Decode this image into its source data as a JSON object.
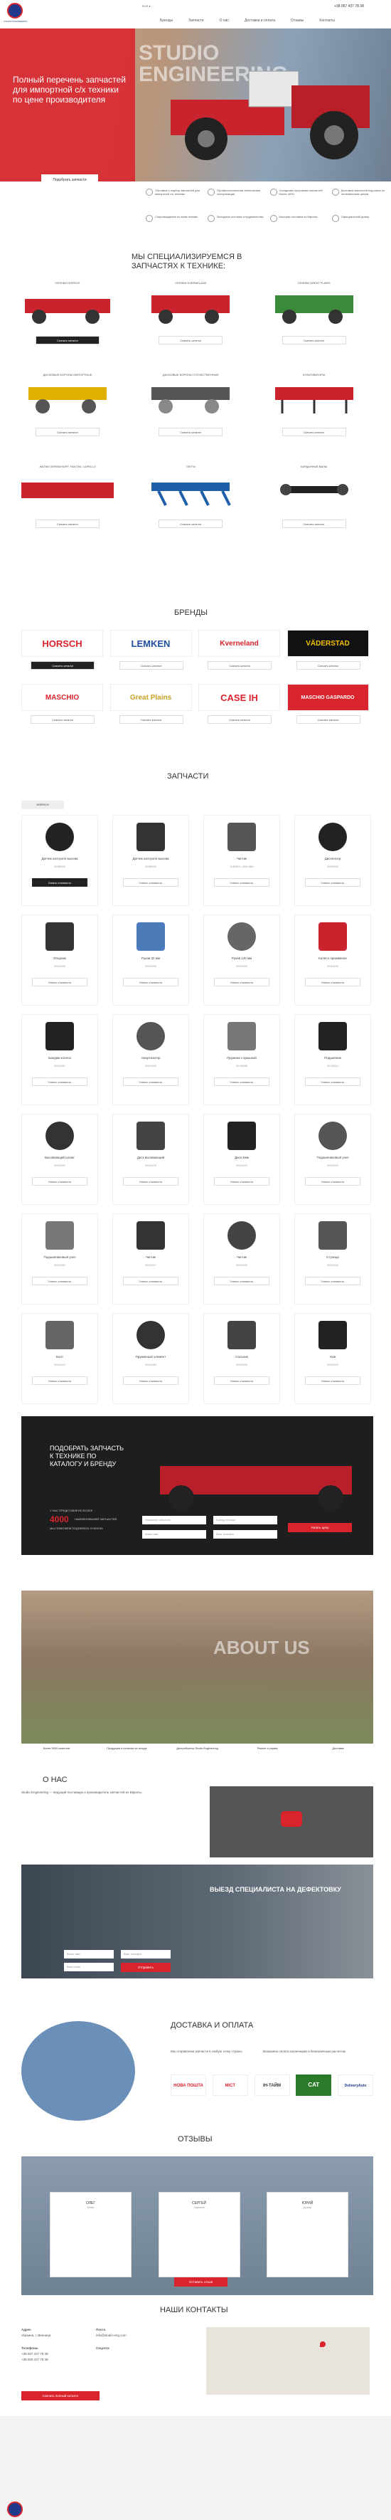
{
  "header": {
    "logo_text": "STUDIO ENGINEERING",
    "topbar": "RUS ▾",
    "phone": "+38 067 437 78 38",
    "nav": [
      "Бренды",
      "Запчасти",
      "О нас",
      "Доставка и оплата",
      "Отзывы",
      "Контакты"
    ]
  },
  "hero": {
    "title": "Полный перечень запчастей для импортной с/х техники по цене производителя",
    "button": "Подобрать запчасти",
    "watermark_line1": "STUDIO",
    "watermark_line2": "ENGINEERING",
    "features": [
      "Поставка и подбор запчастей для импортной с/х техники",
      "Профессиональная техническая консультация",
      "Складская программа запчастей более 4000",
      "Доставка запчастей под заказ по оптимальным ценам",
      "Сопровождение по всем этапам",
      "Выгодные условия сотрудничества",
      "Быстрая поставка из Европы",
      "Официальный дилер"
    ]
  },
  "catalog": {
    "title": "МЫ СПЕЦИАЛИЗИРУЕМСЯ В ЗАПЧАСТЯХ К ТЕХНИКЕ:",
    "items": [
      {
        "name": "СЕЯЛКИ HORSCH",
        "button": "Скачать каталог"
      },
      {
        "name": "СЕЯЛКИ KVERNELAND",
        "button": "Скачать каталог"
      },
      {
        "name": "СЕЯЛКИ GREAT PLAINS",
        "button": "Скачать каталог"
      },
      {
        "name": "ДИСКОВЫЕ БОРОНЫ ИМПОРТНЫЕ",
        "button": "Скачать каталог"
      },
      {
        "name": "ДИСКОВЫЕ БОРОНЫ ОТЕЧЕСТВЕННЫЕ",
        "button": "Скачать каталог"
      },
      {
        "name": "КУЛЬТИВАТОРЫ",
        "button": "Скачать каталог"
      },
      {
        "name": "ЖАТКИ GERINGHOFF, FANTINI, CAPELLO",
        "button": "Скачать каталог"
      },
      {
        "name": "ПЛУГИ",
        "button": "Скачать каталог"
      },
      {
        "name": "КАРДАННЫЕ ВАЛЫ",
        "button": "Скачать каталог"
      }
    ]
  },
  "brands": {
    "title": "БРЕНДЫ",
    "items": [
      {
        "name": "HORSCH",
        "color": "#d9232d",
        "button": "Скачать каталог"
      },
      {
        "name": "LEMKEN",
        "color": "#1e4e9c",
        "button": "Скачать каталог"
      },
      {
        "name": "Kverneland",
        "color": "#d9232d",
        "button": "Скачать каталог"
      },
      {
        "name": "VÄDERSTAD",
        "color": "#f2c200",
        "button": "Скачать каталог"
      },
      {
        "name": "MASCHIO",
        "color": "#d9232d",
        "button": "Скачать каталог"
      },
      {
        "name": "Great Plains",
        "color": "#c9a227",
        "button": "Скачать каталог"
      },
      {
        "name": "CASE IH",
        "color": "#d9232d",
        "button": "Скачать каталог"
      },
      {
        "name": "MASCHIO GASPARDO",
        "color": "#d9232d",
        "button": "Скачать каталог"
      }
    ]
  },
  "parts": {
    "title": "ЗАПЧАСТИ",
    "filter": "HORSCH",
    "button": "Узнать стоимость",
    "items": [
      {
        "name": "Датчик контроля высева",
        "code": "00380026"
      },
      {
        "name": "Датчик контроля высева",
        "code": "00380026"
      },
      {
        "name": "Чистик",
        "code": "01309921, 00310864"
      },
      {
        "name": "Диспенсер",
        "code": "00300000"
      },
      {
        "name": "Опорник",
        "code": "00310400"
      },
      {
        "name": "Рукав 32 мм",
        "code": "00330900"
      },
      {
        "name": "Рукав 145 мм",
        "code": "00330903"
      },
      {
        "name": "Колесо прижимное",
        "code": "00320140"
      },
      {
        "name": "Бандаж колеса",
        "code": "00320301"
      },
      {
        "name": "Амортизатор",
        "code": "00610019"
      },
      {
        "name": "Пружина с крышкой",
        "code": "00100088"
      },
      {
        "name": "Подшипник",
        "code": "00120014"
      },
      {
        "name": "Высевающий шланг",
        "code": "00330001"
      },
      {
        "name": "Диск высевающий",
        "code": "00300075"
      },
      {
        "name": "Диск 4мм",
        "code": "00300019"
      },
      {
        "name": "Подшипниковый узел",
        "code": "00330020"
      },
      {
        "name": "Подшипниковый узел",
        "code": "00310062"
      },
      {
        "name": "Чистик",
        "code": "00310017"
      },
      {
        "name": "Чистик",
        "code": "00200018"
      },
      {
        "name": "Ступица",
        "code": "00320044"
      },
      {
        "name": "Болт",
        "code": "00600010"
      },
      {
        "name": "Пружинный элемент",
        "code": "00310063"
      },
      {
        "name": "Сальник",
        "code": "00320040"
      },
      {
        "name": "Нож",
        "code": "00320019"
      }
    ]
  },
  "selector": {
    "title": "ПОДОБРАТЬ ЗАПЧАСТЬ К ТЕХНИКЕ ПО КАТАЛОГУ И БРЕНДУ",
    "count_prefix": "У НАС ПРЕДСТАВЛЕНО БОЛЕЕ",
    "count": "4000",
    "count_suffix": "НАИМЕНОВАНИЙ ЗАПЧАСТЕЙ.",
    "note": "МЫ ПОМОЖЕМ ПОДОБРАТЬ НУЖНУЮ",
    "fields": [
      "Название запчасти",
      "Бренд техники",
      "Ваше имя",
      "Ваш телефон"
    ],
    "button": "Узнать цену"
  },
  "about": {
    "title": "О НАС",
    "watermark": "ABOUT US",
    "text": "Studio Engineering — ведущий поставщик и производитель запчастей из Европы.",
    "stats": [
      "Более 5000 клиентов",
      "Продукция в наличии на складе",
      "Дистрибьютор Studio Engineering",
      "Ремонт и сервис",
      "Доставка"
    ]
  },
  "specialist": {
    "title": "ВЫЕЗД СПЕЦИАЛИСТА НА ДЕФЕКТОВКУ",
    "fields": [
      "Ваше имя",
      "Ваш телефон",
      "Ваш email"
    ],
    "button": "Отправить"
  },
  "delivery": {
    "title": "ДОСТАВКА И ОПЛАТА",
    "text1": "Мы отправляем запчасти в любую точку страны",
    "text2": "Возможна оплата наличными и безналичным расчетом",
    "carriers": [
      "НОВА ПОШТА",
      "МІСТ",
      "ІН-ТАЙМ",
      "CAT",
      "DeliveryAuto"
    ]
  },
  "reviews": {
    "title": "ОТЗЫВЫ",
    "items": [
      {
        "name": "ОЛЕГ",
        "city": "Киев"
      },
      {
        "name": "СЕРГЕЙ",
        "city": "Харьков"
      },
      {
        "name": "ЮРИЙ",
        "city": "Днепр"
      }
    ],
    "button": "Оставить отзыв"
  },
  "contacts": {
    "title": "НАШИ КОНТАКТЫ",
    "address_label": "Адрес",
    "address": "Украина, г. Винница",
    "phones_label": "Телефоны",
    "phones": [
      "+38 067 437 78 38",
      "+38 050 437 78 38"
    ],
    "email_label": "Почта",
    "email": "info@studio-eng.com",
    "social_label": "Соцсети",
    "button": "Скачать полный каталог"
  },
  "colors": {
    "accent": "#d9232d",
    "dark": "#1e1e1e",
    "brand_blue": "#1f3a8a"
  }
}
